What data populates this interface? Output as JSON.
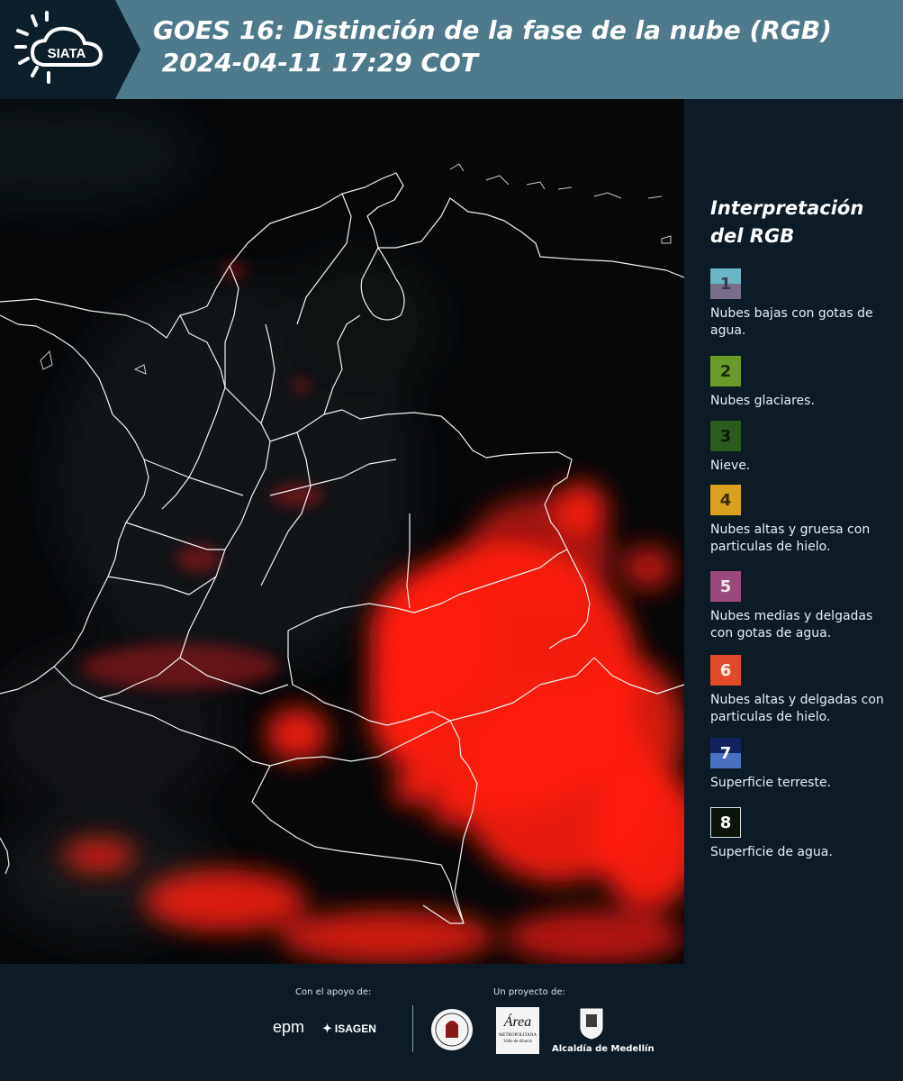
{
  "header": {
    "logo_text": "SIATA",
    "title_line1": "GOES 16: Distinción de la fase de la nube (RGB)",
    "title_line2": " 2024-04-11 17:29 COT"
  },
  "legend": {
    "title_line1": "Interpretación",
    "title_line2": "del RGB",
    "items": [
      {
        "number": "1",
        "label": "Nubes bajas con gotas de agua.",
        "color_top": "#6ab6c4",
        "color_bottom": "#7a6f8a"
      },
      {
        "number": "2",
        "label": "Nubes glaciares.",
        "color": "#6a9a2a"
      },
      {
        "number": "3",
        "label": "Nieve.",
        "color": "#2f5a1e"
      },
      {
        "number": "4",
        "label": "Nubes altas y gruesa con particulas de hielo.",
        "color": "#d8a21c"
      },
      {
        "number": "5",
        "label": "Nubes medias y delgadas con gotas de agua.",
        "color": "#9a4a7a"
      },
      {
        "number": "6",
        "label": "Nubes altas y delgadas con particulas de hielo.",
        "color": "#e04a2a"
      },
      {
        "number": "7",
        "label": "Superficie terreste.",
        "color_top": "#14235e",
        "color_bottom": "#4a70c0"
      },
      {
        "number": "8",
        "label": "Superficie de agua.",
        "color": "#0a140a"
      }
    ]
  },
  "footer": {
    "support_label": "Con el apoyo de:",
    "project_label": "Un proyecto de:",
    "sponsor_epm": "epm",
    "sponsor_isagen": "ISAGEN",
    "area_logo_text": "Área",
    "area_logo_sub1": "METROPOLITANA",
    "area_logo_sub2": "Valle de Aburrá",
    "alcaldia_label": "Alcaldía de Medellín"
  }
}
